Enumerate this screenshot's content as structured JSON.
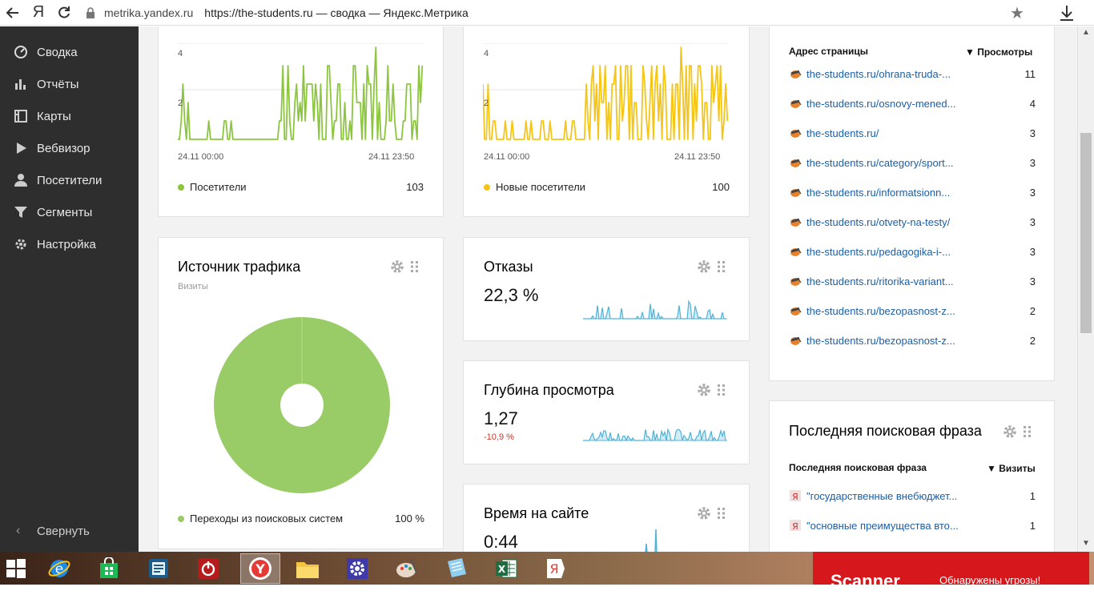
{
  "browser": {
    "yandex_btn": "Я",
    "domain": "metrika.yandex.ru",
    "title": "https://the-students.ru — сводка — Яндекс.Метрика"
  },
  "sidebar": {
    "items": [
      {
        "label": "Сводка",
        "icon": "gauge-icon"
      },
      {
        "label": "Отчёты",
        "icon": "bar-chart-icon"
      },
      {
        "label": "Карты",
        "icon": "map-icon"
      },
      {
        "label": "Вебвизор",
        "icon": "play-icon"
      },
      {
        "label": "Посетители",
        "icon": "user-icon"
      },
      {
        "label": "Сегменты",
        "icon": "funnel-icon"
      },
      {
        "label": "Настройка",
        "icon": "gear-icon"
      }
    ],
    "collapse_label": "Свернуть"
  },
  "visitors_card": {
    "y_tick_top": "4",
    "y_tick_mid": "2",
    "x_start": "24.11 00:00",
    "x_end": "24.11 23:50",
    "legend": "Посетители",
    "total": "103",
    "color": "#8cc63f"
  },
  "new_visitors_card": {
    "y_tick_top": "4",
    "y_tick_mid": "2",
    "x_start": "24.11 00:00",
    "x_end": "24.11 23:50",
    "legend": "Новые посетители",
    "total": "100",
    "color": "#f5c518"
  },
  "traffic_card": {
    "title": "Источник трафика",
    "subtitle": "Визиты",
    "legend": "Переходы из поисковых систем",
    "percent": "100 %",
    "color": "#99cc66"
  },
  "bounce_card": {
    "title": "Отказы",
    "value": "22,3 %"
  },
  "depth_card": {
    "title": "Глубина просмотра",
    "value": "1,27",
    "delta": "-10,9 %"
  },
  "time_card": {
    "title": "Время на сайте",
    "value": "0:44"
  },
  "pages_card": {
    "col_page": "Адрес страницы",
    "col_views": "▼ Просмотры",
    "rows": [
      {
        "url": "the-students.ru/ohrana-truda-...",
        "views": "11"
      },
      {
        "url": "the-students.ru/osnovy-mened...",
        "views": "4"
      },
      {
        "url": "the-students.ru/",
        "views": "3"
      },
      {
        "url": "the-students.ru/category/sport...",
        "views": "3"
      },
      {
        "url": "the-students.ru/informatsionn...",
        "views": "3"
      },
      {
        "url": "the-students.ru/otvety-na-testy/",
        "views": "3"
      },
      {
        "url": "the-students.ru/pedagogika-i-...",
        "views": "3"
      },
      {
        "url": "the-students.ru/ritorika-variant...",
        "views": "3"
      },
      {
        "url": "the-students.ru/bezopasnost-z...",
        "views": "2"
      },
      {
        "url": "the-students.ru/bezopasnost-z...",
        "views": "2"
      }
    ]
  },
  "search_card": {
    "title": "Последняя поисковая фраза",
    "col_phrase": "Последняя поисковая фраза",
    "col_visits": "▼ Визиты",
    "rows": [
      {
        "phrase": "\"государственные внебюджет...",
        "visits": "1"
      },
      {
        "phrase": "\"основные преимущества вто...",
        "visits": "1"
      }
    ]
  },
  "taskbar": {
    "apps": [
      "windows-start-icon",
      "internet-explorer-icon",
      "store-icon",
      "task-manager-icon",
      "power-icon",
      "yandex-browser-icon",
      "file-explorer-icon",
      "settings-icon",
      "paint-icon",
      "notepad-icon",
      "excel-icon",
      "yandex-icon"
    ],
    "scanner_title": "Scanner",
    "scanner_msg": "Обнаружены угрозы!"
  }
}
